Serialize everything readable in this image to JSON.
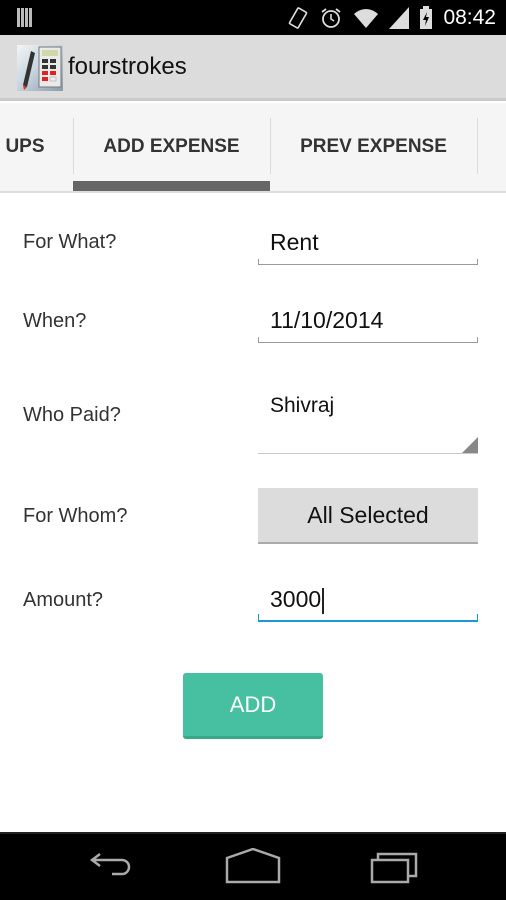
{
  "status_bar": {
    "time": "08:42",
    "icons": [
      "notification-icon",
      "vibrate-icon",
      "alarm-icon",
      "wifi-icon",
      "signal-icon",
      "battery-charging-icon"
    ]
  },
  "action_bar": {
    "app_title": "fourstrokes",
    "app_icon": "calculator-pen-app-icon"
  },
  "tabs": [
    {
      "label": "UPS",
      "selected": false
    },
    {
      "label": "ADD EXPENSE",
      "selected": true
    },
    {
      "label": "PREV EXPENSE",
      "selected": false
    }
  ],
  "form": {
    "for_what": {
      "label": "For What?",
      "value": "Rent"
    },
    "when": {
      "label": "When?",
      "value": "11/10/2014"
    },
    "who_paid": {
      "label": "Who Paid?",
      "value": "Shivraj"
    },
    "for_whom": {
      "label": "For Whom?",
      "value": "All Selected"
    },
    "amount": {
      "label": "Amount?",
      "value": "3000"
    },
    "submit_label": "ADD"
  },
  "colors": {
    "accent_teal": "#46c0a0",
    "focus_blue": "#1a9ad3",
    "tab_indicator": "#666666"
  },
  "nav_bar": {
    "buttons": [
      "back-icon",
      "home-icon",
      "recent-apps-icon"
    ]
  }
}
